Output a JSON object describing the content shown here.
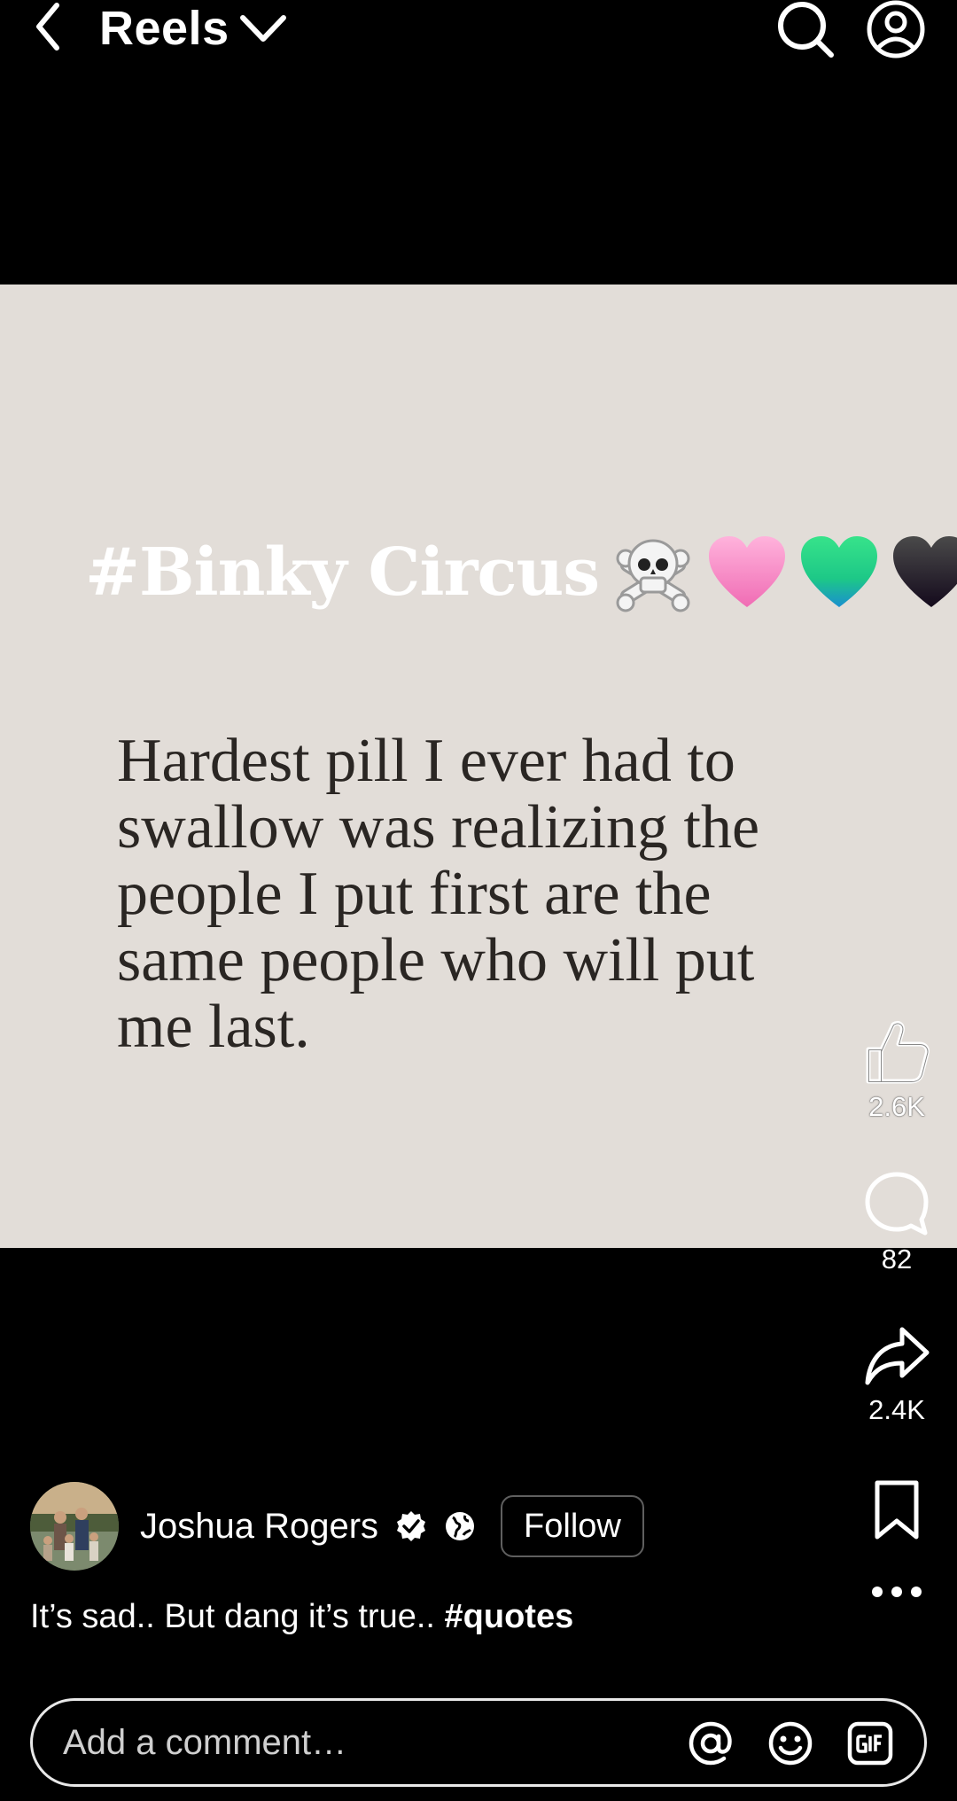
{
  "header": {
    "title": "Reels"
  },
  "video": {
    "tag_text": "#Binky Circus",
    "emojis": [
      "☠️",
      "🩷",
      "💚",
      "🖤"
    ],
    "quote_lines": [
      "Hardest pill I ever had to",
      "swallow was realizing the",
      "people I put first are the",
      "same people who will put",
      "me last."
    ]
  },
  "actions": {
    "like_count": "2.6K",
    "comment_count": "82",
    "share_count": "2.4K"
  },
  "author": {
    "name": "Joshua Rogers",
    "follow_label": "Follow"
  },
  "caption": {
    "text": "It’s sad.. But dang it’s true..",
    "hashtag": "#quotes"
  },
  "comment_bar": {
    "placeholder": "Add a comment…"
  },
  "icons": {
    "back": "chevron-left-icon",
    "title_dropdown": "chevron-down-icon",
    "search": "search-icon",
    "profile": "user-circle-icon",
    "like": "thumbs-up-icon",
    "comment": "comment-bubble-icon",
    "share": "share-arrow-icon",
    "save": "bookmark-icon",
    "more": "more-dots-icon",
    "verified": "verified-badge-icon",
    "audience": "globe-icon",
    "mention": "at-sign-icon",
    "emoji": "smiley-icon",
    "gif": "gif-icon"
  }
}
